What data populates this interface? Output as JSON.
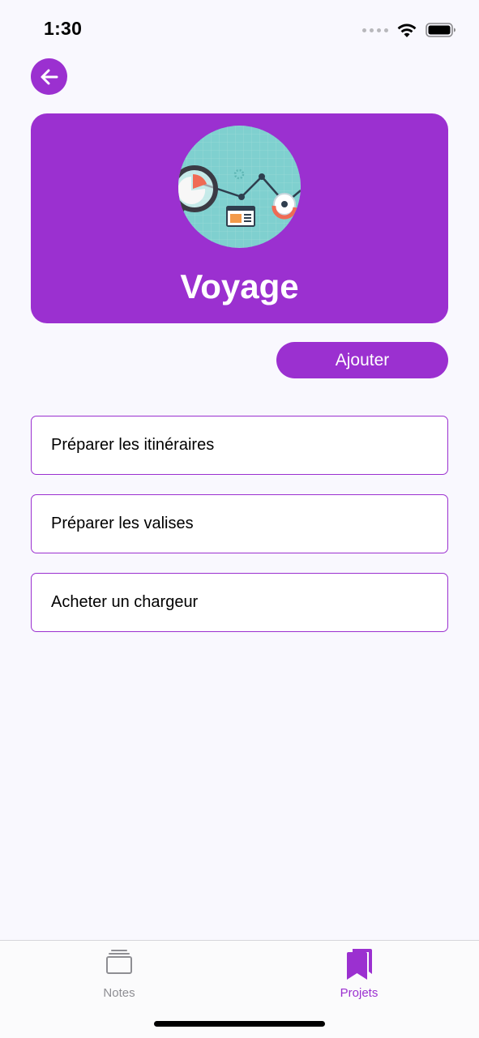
{
  "status_bar": {
    "time": "1:30",
    "icons": [
      "signal-dots-icon",
      "wifi-icon",
      "battery-icon"
    ]
  },
  "navigation": {
    "back_icon": "arrow-left-icon"
  },
  "project": {
    "title": "Voyage",
    "image_description_icon": "analytics-illustration-icon"
  },
  "actions": {
    "add_label": "Ajouter"
  },
  "tasks": [
    {
      "label": "Préparer les itinéraires"
    },
    {
      "label": "Préparer les valises"
    },
    {
      "label": "Acheter un chargeur"
    }
  ],
  "tab_bar": {
    "tabs": [
      {
        "label": "Notes",
        "icon": "stack-icon",
        "active": false
      },
      {
        "label": "Projets",
        "icon": "bookmarks-icon",
        "active": true
      }
    ]
  },
  "colors": {
    "accent": "#9b30d0",
    "background": "#f9f8fe",
    "inactive_tab": "#8e8e93",
    "illustration_bg": "#7fd0cf"
  }
}
